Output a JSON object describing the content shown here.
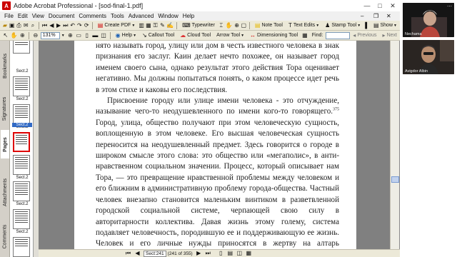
{
  "window": {
    "title": "Adobe Acrobat Professional - [sod-final-1.pdf]",
    "app_icon": "A",
    "minimize": "—",
    "maximize": "□",
    "close": "✕",
    "doc_minimize": "–",
    "doc_restore": "❐",
    "doc_close": "✕"
  },
  "menu": [
    "File",
    "Edit",
    "View",
    "Document",
    "Comments",
    "Tools",
    "Advanced",
    "Window",
    "Help"
  ],
  "toolbar1": {
    "create_pdf": "Create PDF",
    "typewriter": "Typewriter",
    "note_tool": "Note Tool",
    "text_edits": "Text Edits",
    "stamp_tool": "Stamp Tool",
    "show": "Show"
  },
  "toolbar2": {
    "zoom": "131%",
    "help": "Help",
    "callout_tool": "Callout Tool",
    "cloud_tool": "Cloud Tool",
    "arrow_tool": "Arrow Tool",
    "dimensioning_tool": "Dimensioning Tool",
    "find_label": "Find:",
    "previous": "Previous",
    "next": "Next"
  },
  "nav_tabs": [
    "Bookmarks",
    "Signatures",
    "Pages",
    "Attachments",
    "Comments"
  ],
  "thumbnails": [
    {
      "label": "Sect.2",
      "selected": false
    },
    {
      "label": "Sect.2",
      "selected": false
    },
    {
      "label": "Sect.2",
      "selected": false
    },
    {
      "label": "Sect.2",
      "selected": true
    },
    {
      "label": "Sect.2",
      "selected": false
    },
    {
      "label": "Sect.2",
      "selected": false
    },
    {
      "label": "Sect.2",
      "selected": false
    },
    {
      "label": "Sect.2",
      "selected": false
    },
    {
      "label": "Sect.2",
      "selected": false
    },
    {
      "label": "Sect.2",
      "selected": false
    }
  ],
  "document": {
    "paragraph1": "нято называть город, улицу или дом в честь известного человека в знак признания его заслуг. Каин делает нечто похожее, он называет город именем своего сына, однако результат этого действия Тора оценивает негативно. Мы должны попытаться понять, о каком процессе идет речь в этом стихе и каковы его последствия.",
    "paragraph2_start": "Присвоение городу или улице имени человека - это отчуждение, называние чего-то неодушевленного по имени кого-то говорящего.",
    "footnote": "375",
    "paragraph2_rest": " Город, улица, общество получают при этом человеческую сущность, воплощенную в этом человеке. Его высшая человеческая сущность переносится на неодушевленный предмет. Здесь говорится о городе в широком смысле этого слова: это общество или «мегаполис», в анти-нравственном социальном значении. Процесс, который описывает нам Тора, — это превращение нравственной проблемы между человеком и его ближним в административную проблему города-общества. Частный человек внезапно становится маленьким винтиком в разветвленной городской социальной системе, черпающей свою силу в авторитарности коллектива. Давая жизнь этому голему, система подавляет человечность, породившую ее и поддерживающую ее жизнь. Человек и его личные нужды приносятся в жертву на алтарь потребностей"
  },
  "status": {
    "page_box": "Sect:241",
    "page_count": "(241 of 355)"
  },
  "call": {
    "participant1": "Nechama",
    "participant2": "Avigdor Albin"
  }
}
